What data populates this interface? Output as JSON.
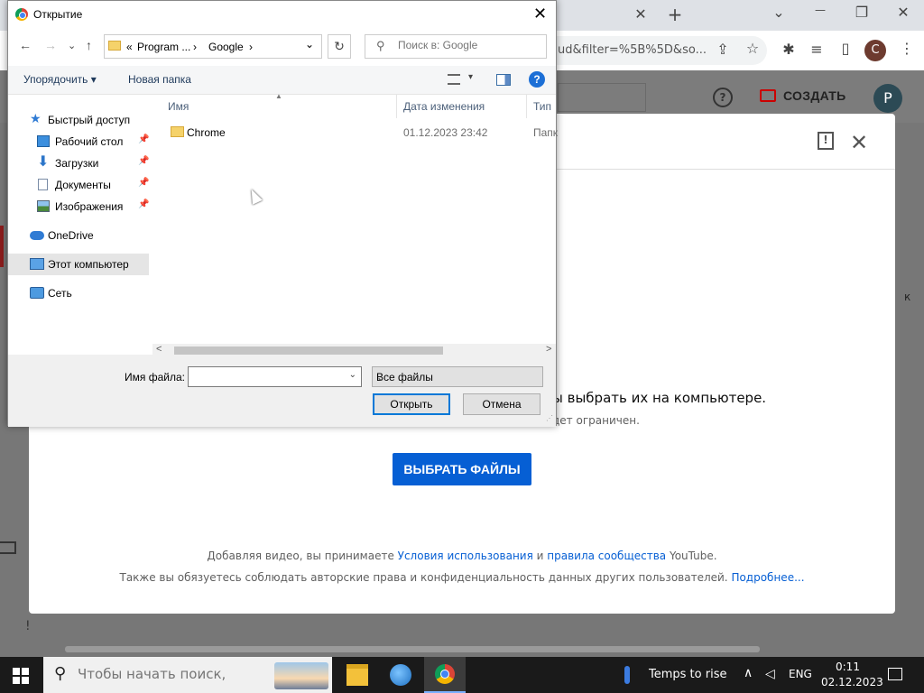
{
  "browser": {
    "tab_close": "✕",
    "new_tab": "+",
    "url_fragment": "ud&filter=%5B%5D&so...",
    "profile_initial": "C",
    "window_controls": {
      "menu": "⌄",
      "minimize": "—",
      "restore": "❐",
      "close": "✕"
    }
  },
  "studio": {
    "create_label": "СОЗДАТЬ",
    "avatar_initial": "P",
    "help": "?",
    "side_letter": "к"
  },
  "upload_modal": {
    "drag_text": "ы выбрать их на компьютере.",
    "sub_text": "дет ограничен.",
    "select_button": "ВЫБРАТЬ ФАЙЛЫ",
    "terms_line1_prefix": "Добавляя видео, вы принимаете ",
    "terms_link1": "Условия использования",
    "terms_and": " и ",
    "terms_link2": "правила сообщества",
    "terms_line1_suffix": " YouTube.",
    "terms_line2_prefix": "Также вы обязуетесь соблюдать авторские права и конфиденциальность данных других пользователей. ",
    "terms_link3": "Подробнее..."
  },
  "dialog": {
    "title": "Открытие",
    "close": "✕",
    "nav": {
      "back": "←",
      "forward": "→",
      "recent": "⌄",
      "up": "↑",
      "refresh": "↻"
    },
    "address": {
      "prefix": "«",
      "seg1": "Program ...",
      "sep": "›",
      "seg2": "Google",
      "sep2": "›",
      "dropdown": "⌄"
    },
    "search_placeholder": "Поиск в: Google",
    "commands": {
      "organize": "Упорядочить ▾",
      "new_folder": "Новая папка",
      "view_arrow": "▾",
      "help": "?"
    },
    "nav_pane": [
      {
        "label": "Быстрый доступ",
        "icon": "star-icon"
      },
      {
        "label": "Рабочий стол",
        "icon": "desktop-icon",
        "pinned": true
      },
      {
        "label": "Загрузки",
        "icon": "download-icon",
        "pinned": true
      },
      {
        "label": "Документы",
        "icon": "document-icon",
        "pinned": true
      },
      {
        "label": "Изображения",
        "icon": "image-icon",
        "pinned": true
      },
      {
        "label": "OneDrive",
        "icon": "cloud-icon"
      },
      {
        "label": "Этот компьютер",
        "icon": "computer-icon",
        "selected": true
      },
      {
        "label": "Сеть",
        "icon": "network-icon"
      }
    ],
    "columns": {
      "name": "Имя",
      "date": "Дата изменения",
      "type": "Тип"
    },
    "files": [
      {
        "name": "Chrome",
        "date": "01.12.2023 23:42",
        "type": "Папк"
      }
    ],
    "filename_label": "Имя файла:",
    "filename_value": "",
    "filetype": "Все файлы",
    "open_button": "Открыть",
    "cancel_button": "Отмена"
  },
  "taskbar": {
    "search_placeholder": "Чтобы начать поиск,",
    "weather": "Temps to rise",
    "language": "ENG",
    "time": "0:11",
    "date": "02.12.2023"
  }
}
